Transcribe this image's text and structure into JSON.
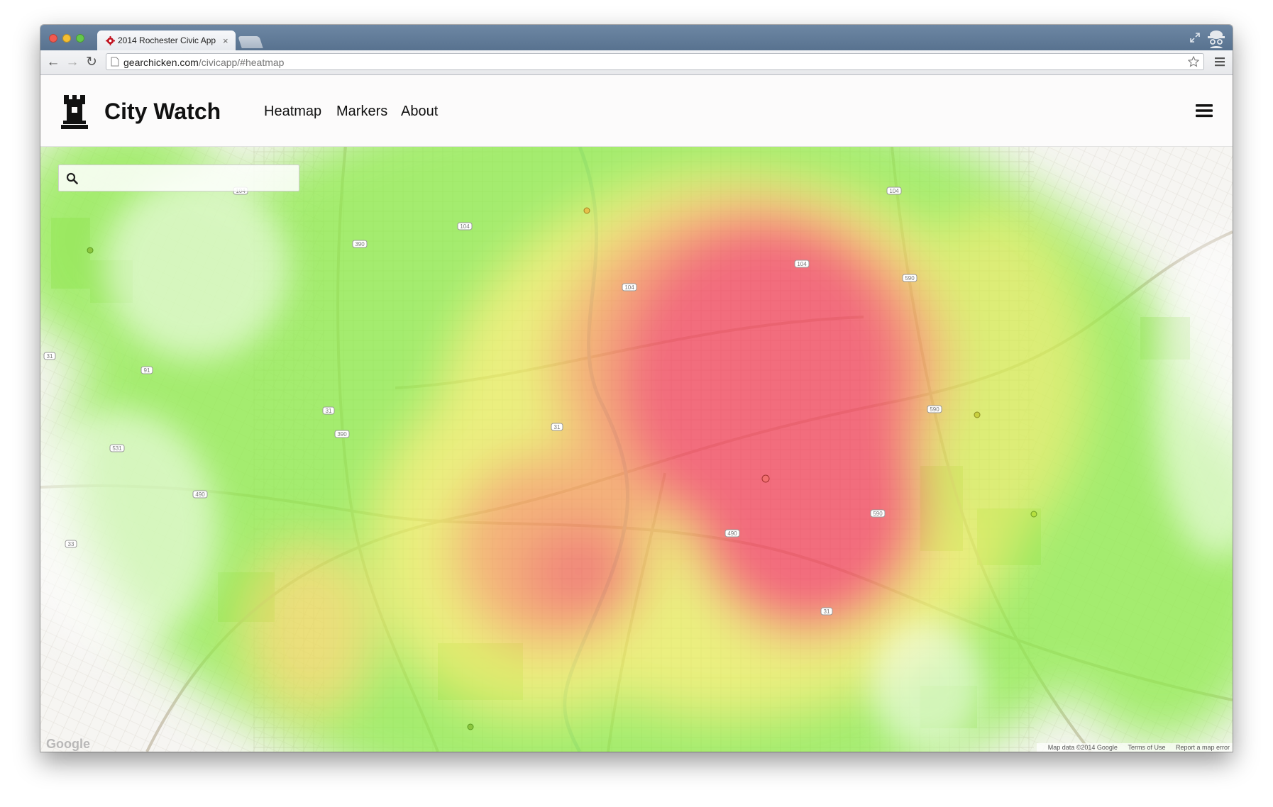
{
  "browser": {
    "tab_title": "2014 Rochester Civic App",
    "tab_close": "×",
    "url_host": "gearchicken.com",
    "url_path": "/civicapp/#heatmap",
    "back": "←",
    "forward": "→",
    "reload": "↻"
  },
  "app": {
    "brand": "City Watch",
    "nav": {
      "heatmap": "Heatmap",
      "markers": "Markers",
      "about": "About"
    }
  },
  "map": {
    "search_value": "",
    "google_logo": "Google",
    "attribution": {
      "data": "Map data ©2014 Google",
      "terms": "Terms of Use",
      "report": "Report a map error"
    },
    "route_shields": [
      "104",
      "104",
      "104",
      "104",
      "104",
      "390",
      "390",
      "590",
      "590",
      "590",
      "31",
      "31",
      "31",
      "91",
      "531",
      "490",
      "490",
      "33",
      "31"
    ]
  },
  "colors": {
    "heat_red": "#f2455d",
    "heat_yellow": "#f4f06a",
    "heat_green": "#8ee84a",
    "header_bg": "#fcfbfb"
  }
}
